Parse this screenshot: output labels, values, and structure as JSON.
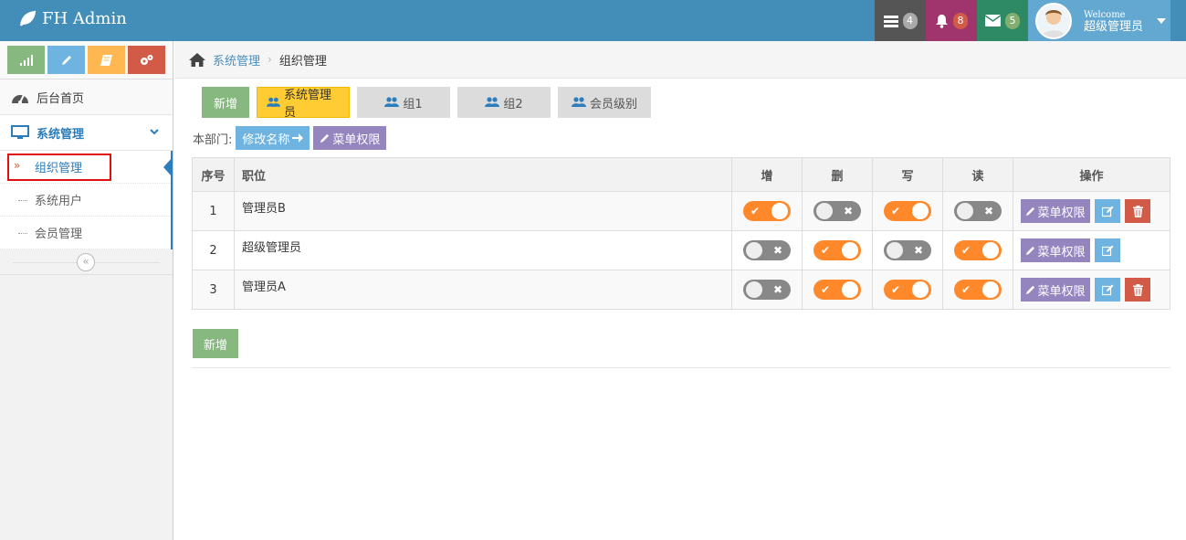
{
  "brand": {
    "title": "FH Admin"
  },
  "navbar": {
    "tasks_count": "4",
    "notifications_count": "8",
    "messages_count": "5",
    "user": {
      "welcome": "Welcome",
      "name": "超级管理员"
    }
  },
  "sidebar": {
    "home": "后台首页",
    "system": "系统管理",
    "items": [
      {
        "label": "组织管理",
        "active": true
      },
      {
        "label": "系统用户",
        "active": false
      },
      {
        "label": "会员管理",
        "active": false
      }
    ]
  },
  "breadcrumb": {
    "parent": "系统管理",
    "current": "组织管理"
  },
  "toolbar": {
    "add_label": "新增",
    "tabs": [
      "系统管理员",
      "组1",
      "组2",
      "会员级别"
    ]
  },
  "department": {
    "label": "本部门:",
    "rename_label": "修改名称",
    "menu_perm_label": "菜单权限"
  },
  "table": {
    "headers": [
      "序号",
      "职位",
      "增",
      "删",
      "写",
      "读",
      "操作"
    ],
    "rows": [
      {
        "index": "1",
        "name": "管理员B",
        "add": true,
        "del": false,
        "write": true,
        "read": false,
        "deletable": true
      },
      {
        "index": "2",
        "name": "超级管理员",
        "add": false,
        "del": true,
        "write": false,
        "read": true,
        "deletable": false
      },
      {
        "index": "3",
        "name": "管理员A",
        "add": false,
        "del": true,
        "write": true,
        "read": true,
        "deletable": true
      }
    ],
    "menu_perm_label": "菜单权限"
  },
  "footer": {
    "add_label": "新增"
  },
  "colors": {
    "navbar": "#438eb9",
    "toggle_on": "#ff892a",
    "toggle_off": "#888888",
    "active_tab": "#ffcc33",
    "purple": "#9585bf",
    "highlight": "#e01010"
  }
}
